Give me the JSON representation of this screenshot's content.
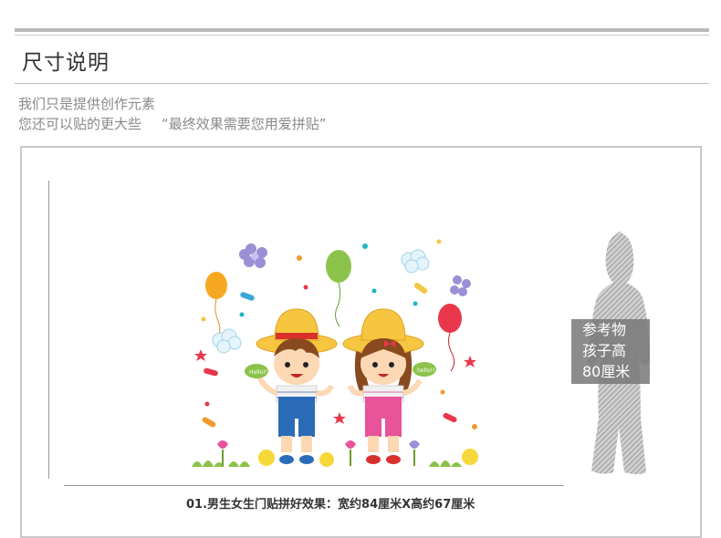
{
  "section": {
    "title": "尺寸说明",
    "desc_line1": "我们只是提供创作元素",
    "desc_line2_a": "您还可以贴的更大些",
    "desc_line2_b": "“最终效果需要您用爱拼贴”"
  },
  "reference": {
    "line1": "参考物",
    "line2": "孩子高",
    "line3": "80厘米"
  },
  "sticker": {
    "boy_bubble": "Hello!!",
    "girl_bubble": "hello!!"
  },
  "caption": "01.男生女生门贴拼好效果：宽约84厘米X高约67厘米"
}
